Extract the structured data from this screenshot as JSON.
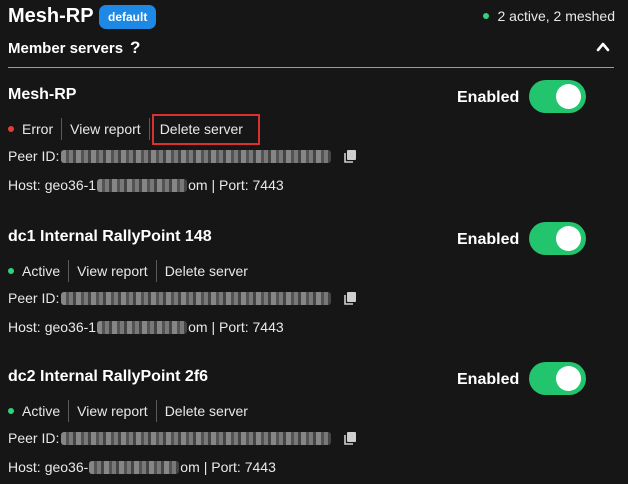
{
  "header": {
    "title": "Mesh-RP",
    "badge": "default",
    "status_summary": "2 active, 2 meshed"
  },
  "section": {
    "title": "Member servers",
    "help": "?"
  },
  "labels": {
    "enabled": "Enabled",
    "view_report": "View report",
    "delete_server": "Delete server",
    "peer_id": "Peer ID:",
    "host": "Host:",
    "port": "| Port: 7443"
  },
  "servers": [
    {
      "name": "Mesh-RP",
      "status": "Error",
      "host_prefix": "geo36-1",
      "host_suffix": "om"
    },
    {
      "name": "dc1 Internal RallyPoint 148",
      "status": "Active",
      "host_prefix": "geo36-1",
      "host_suffix": "om"
    },
    {
      "name": "dc2 Internal RallyPoint 2f6",
      "status": "Active",
      "host_prefix": "geo36-",
      "host_suffix": "om"
    }
  ],
  "colors": {
    "background": "#161616",
    "badge": "#1e88e5",
    "toggle_on": "#22c46e",
    "status_active": "#2ed47a",
    "status_error": "#e53b3b",
    "highlight": "#d93030"
  }
}
